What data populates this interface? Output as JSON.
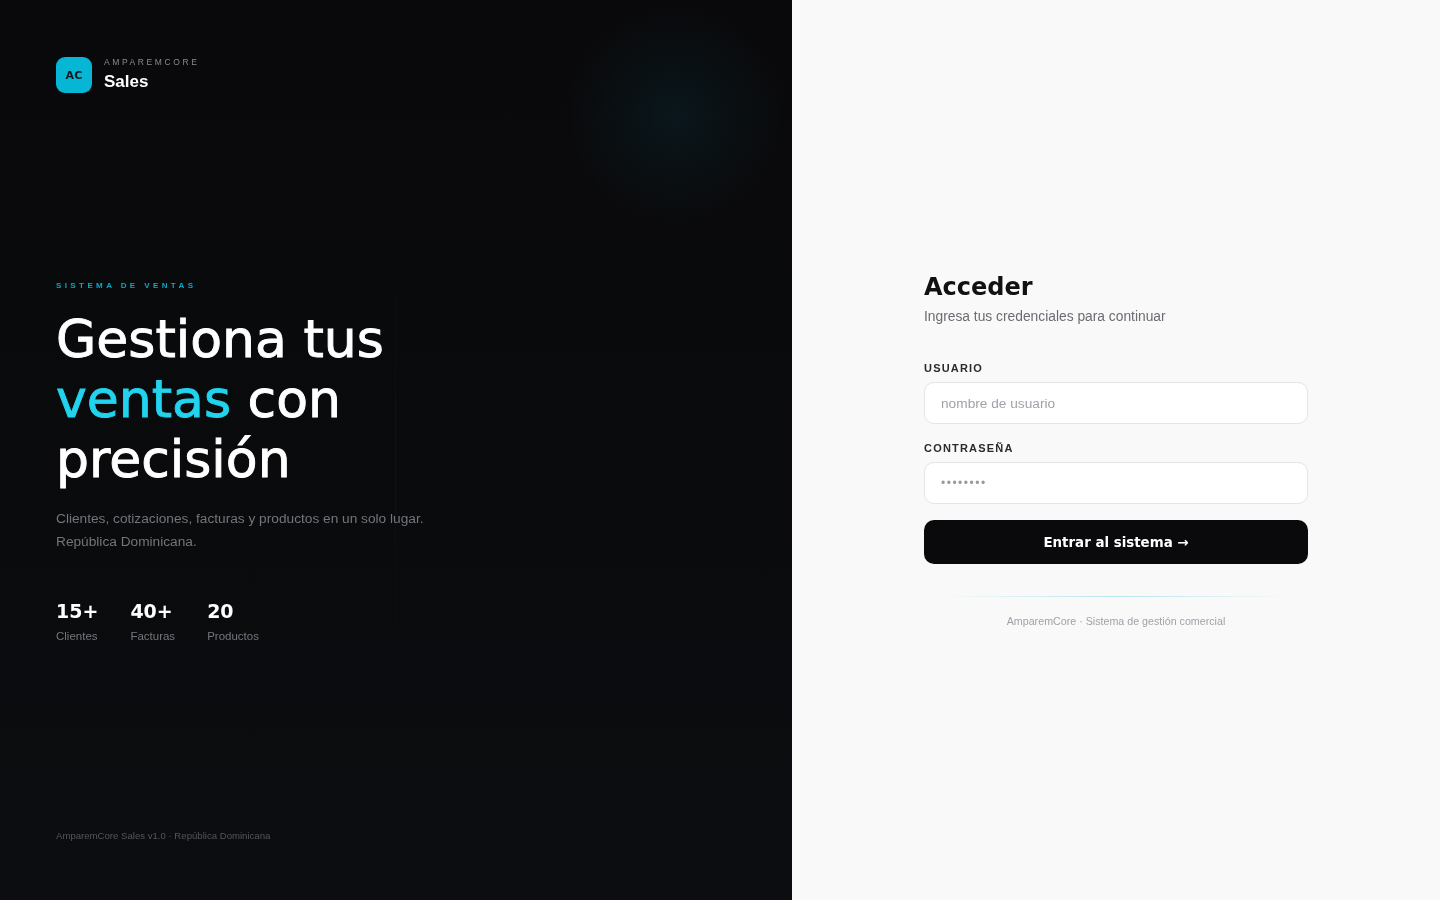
{
  "brand": {
    "logo": "AC",
    "company": "AMPAREMCORE",
    "product": "Sales"
  },
  "hero": {
    "eyebrow": "SISTEMA DE VENTAS",
    "headline": [
      {
        "text": "Gestiona tus",
        "highlighted": false
      },
      {
        "text": "ventas",
        "highlighted": true
      },
      {
        "text": "con precisión",
        "highlighted": false
      }
    ],
    "description_lines": [
      "Clientes, cotizaciones, facturas y productos en un solo lugar.",
      "República Dominicana."
    ],
    "stats": [
      {
        "value": "15+",
        "label": "Clientes"
      },
      {
        "value": "40+",
        "label": "Facturas"
      },
      {
        "value": "20",
        "label": "Productos"
      }
    ],
    "footer": "AmparemCore Sales v1.0 · República Dominicana"
  },
  "login": {
    "title": "Acceder",
    "subtitle": "Ingresa tus credenciales para continuar",
    "fields": [
      {
        "label": "USUARIO",
        "placeholder": "nombre de usuario",
        "kind": "text"
      },
      {
        "label": "CONTRASEÑA",
        "placeholder": "••••••••",
        "kind": "password"
      }
    ],
    "submit": "Entrar al sistema →",
    "footer": "AmparemCore · Sistema de gestión comercial"
  }
}
